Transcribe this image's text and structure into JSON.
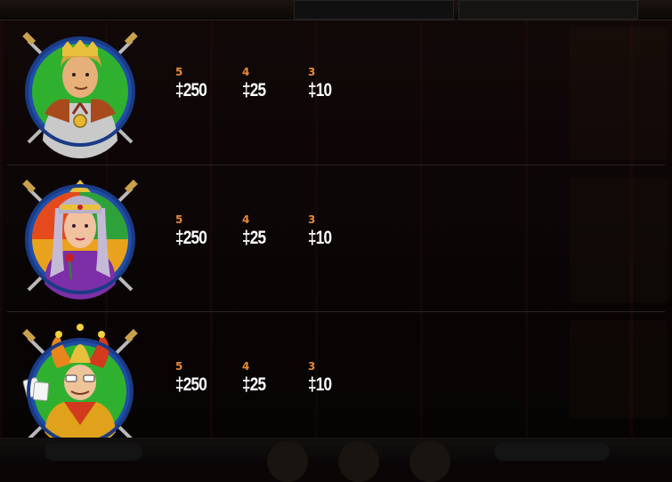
{
  "header": {
    "title_fragment": "",
    "balance_text": "",
    "promo_text": ""
  },
  "paytable": [
    {
      "symbol": "king-icon",
      "pays": [
        {
          "count": "5",
          "value": "‡250"
        },
        {
          "count": "4",
          "value": "‡25"
        },
        {
          "count": "3",
          "value": "‡10"
        }
      ]
    },
    {
      "symbol": "queen-icon",
      "pays": [
        {
          "count": "5",
          "value": "‡250"
        },
        {
          "count": "4",
          "value": "‡25"
        },
        {
          "count": "3",
          "value": "‡10"
        }
      ]
    },
    {
      "symbol": "jester-icon",
      "pays": [
        {
          "count": "5",
          "value": "‡250"
        },
        {
          "count": "4",
          "value": "‡25"
        },
        {
          "count": "3",
          "value": "‡10"
        }
      ]
    }
  ],
  "footer": {
    "bet_text": "",
    "win_text": ""
  },
  "colors": {
    "count_label": "#e78a36",
    "value_text": "#ffffff",
    "background": "#0b0606",
    "divider": "#2d2424"
  }
}
